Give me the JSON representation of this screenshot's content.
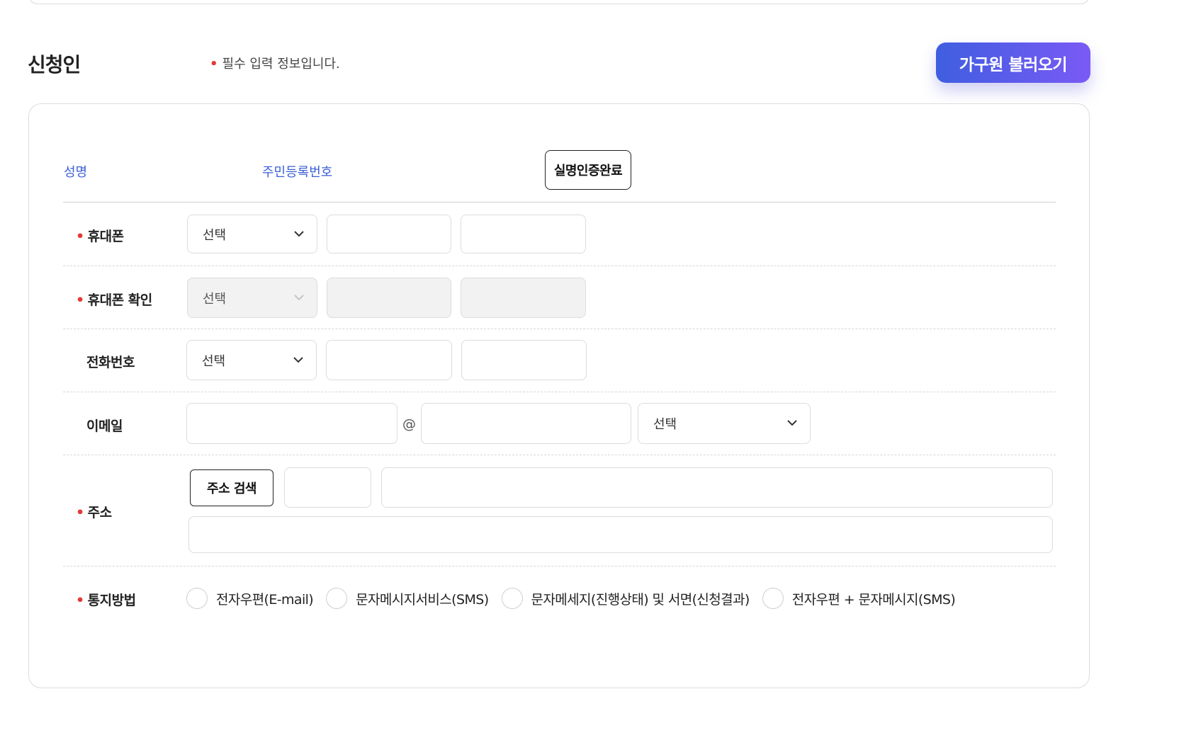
{
  "section": {
    "title": "신청인",
    "required_note": "필수 입력 정보입니다.",
    "family_button": "가구원 불러오기"
  },
  "identity": {
    "name_label": "성명",
    "rrn_label": "주민등록번호",
    "verify_button": "실명인증완료"
  },
  "fields": {
    "mobile": {
      "label": "휴대폰",
      "select": "선택"
    },
    "mobile_confirm": {
      "label": "휴대폰 확인",
      "select": "선택"
    },
    "phone": {
      "label": "전화번호",
      "select": "선택"
    },
    "email": {
      "label": "이메일",
      "at": "@",
      "select": "선택"
    },
    "address": {
      "label": "주소",
      "search_button": "주소 검색"
    },
    "notify": {
      "label": "통지방법",
      "options": [
        "전자우편(E-mail)",
        "문자메시지서비스(SMS)",
        "문자메세지(진행상태) 및 서면(신청결과)",
        "전자우편 + 문자메시지(SMS)"
      ]
    }
  },
  "colors": {
    "accent_blue": "#3b5fd6",
    "required_dot": "#e53935",
    "button_gradient_start": "#3f5ee0",
    "button_gradient_end": "#7a5af5"
  }
}
